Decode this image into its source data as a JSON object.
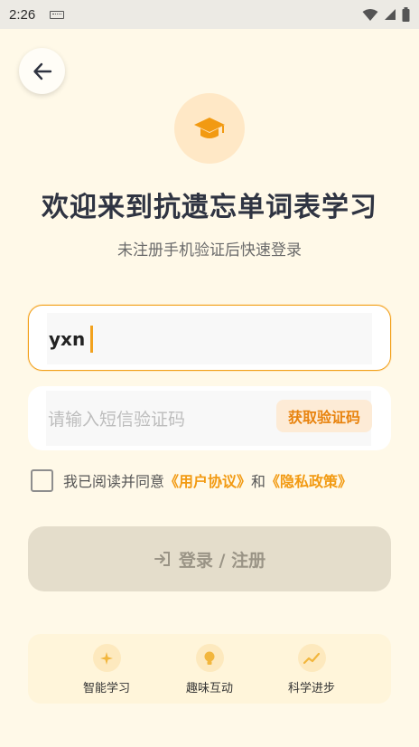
{
  "status_bar": {
    "time": "2:26",
    "icons": [
      "keyboard-icon",
      "wifi-icon",
      "signal-icon",
      "battery-icon"
    ]
  },
  "header": {
    "back_icon": "arrow-left-icon",
    "logo_icon": "graduation-cap-icon"
  },
  "title": "欢迎来到抗遗忘单词表学习",
  "subtitle": "未注册手机验证后快速登录",
  "phone_input": {
    "value": "yxn"
  },
  "code_input": {
    "placeholder": "请输入短信验证码",
    "get_code_label": "获取验证码"
  },
  "agreement": {
    "prefix": "我已阅读并同意",
    "user_agreement": "《用户协议》",
    "and": "和",
    "privacy_policy": "《隐私政策》",
    "checked": false
  },
  "login_button": {
    "label": "登录 / 注册",
    "icon": "login-icon"
  },
  "features": [
    {
      "label": "智能学习",
      "icon": "sparkle-icon"
    },
    {
      "label": "趣味互动",
      "icon": "lightbulb-icon"
    },
    {
      "label": "科学进步",
      "icon": "trend-up-icon"
    }
  ],
  "colors": {
    "accent": "#F2A21E",
    "background": "#FFF9E8",
    "login_disabled": "#E4DDCB"
  }
}
